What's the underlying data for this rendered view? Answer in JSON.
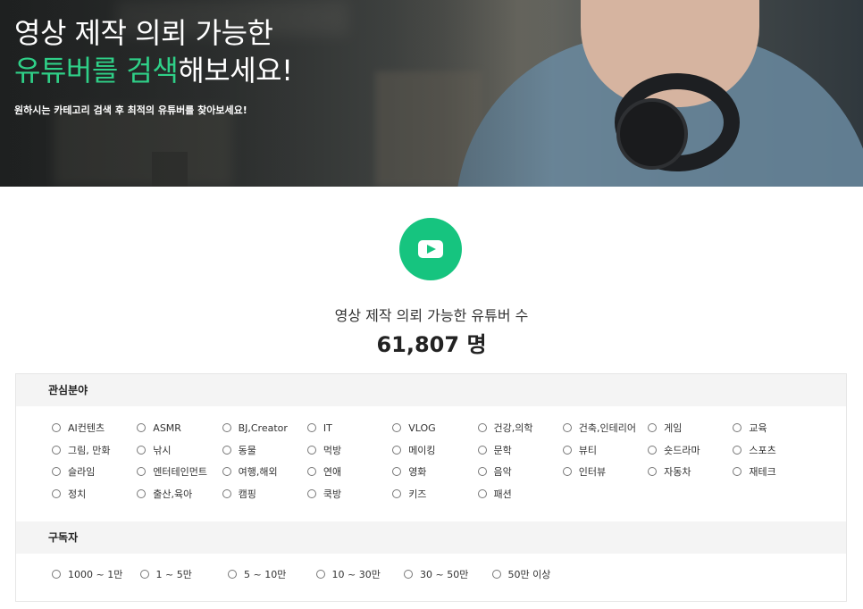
{
  "hero": {
    "title_line1": "영상 제작 의뢰 가능한",
    "title_accent": "유튜버를 검색",
    "title_rest": "해보세요!",
    "subtitle": "원하시는 카테고리 검색 후 최적의 유튜버를 찾아보세요!"
  },
  "stats": {
    "label": "영상 제작 의뢰 가능한 유튜버 수",
    "count": "61,807 명"
  },
  "colors": {
    "accent": "#16c47f",
    "accent_text": "#2fd088"
  },
  "icons": {
    "youtube": "youtube-play-icon"
  },
  "interest": {
    "heading": "관심분야",
    "options": [
      "AI컨텐츠",
      "ASMR",
      "BJ,Creator",
      "IT",
      "VLOG",
      "건강,의학",
      "건축,인테리어",
      "게임",
      "교육",
      "그림, 만화",
      "낚시",
      "동물",
      "먹방",
      "메이킹",
      "문학",
      "뷰티",
      "숏드라마",
      "스포츠",
      "슬라임",
      "엔터테인먼트",
      "여행,해외",
      "연애",
      "영화",
      "음악",
      "인터뷰",
      "자동차",
      "재테크",
      "정치",
      "출산,육아",
      "캠핑",
      "쿡방",
      "키즈",
      "패션"
    ]
  },
  "subscribers": {
    "heading": "구독자",
    "options": [
      "1000 ~ 1만",
      "1 ~ 5만",
      "5 ~ 10만",
      "10 ~ 30만",
      "30 ~ 50만",
      "50만 이상"
    ]
  }
}
